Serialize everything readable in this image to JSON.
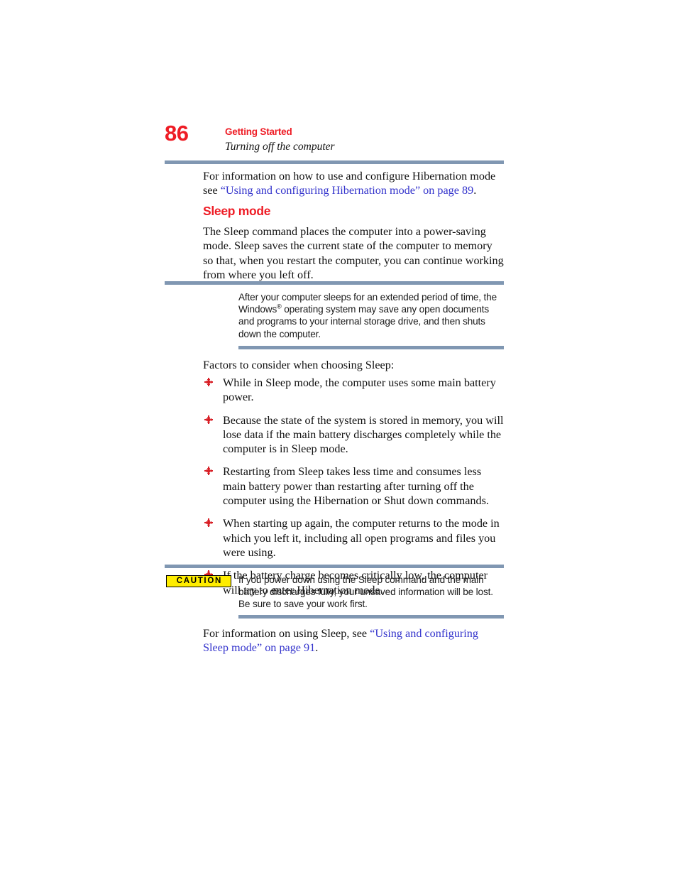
{
  "header": {
    "page_number": "86",
    "chapter": "Getting Started",
    "section": "Turning off the computer"
  },
  "colors": {
    "accent_red": "#ee1c25",
    "rule_blue": "#8097b2",
    "link_blue": "#3333cc",
    "caution_yellow": "#ffed00"
  },
  "content": {
    "hibernation_paragraph": {
      "lead": "For information on how to use and configure Hibernation mode see ",
      "link": "“Using and configuring Hibernation mode” on page 89",
      "tail": "."
    },
    "sleep_heading": "Sleep mode",
    "sleep_description": "The Sleep command places the computer into a power-saving mode. Sleep saves the current state of the computer to memory so that, when you restart the computer, you can continue working from where you left off.",
    "note": {
      "text_before_mark": "After your computer sleeps for an extended period of time, the Windows",
      "trademark": "®",
      "text_after_mark": " operating system may save any open documents and programs to your internal storage drive, and then shuts down the computer."
    },
    "factors_intro": "Factors to consider when choosing Sleep:",
    "bullets": [
      "While in Sleep mode, the computer uses some main battery power.",
      "Because the state of the system is stored in memory, you will lose data if the main battery discharges completely while the computer is in Sleep mode.",
      "Restarting from Sleep takes less time and consumes less main battery power than restarting after turning off the computer using the Hibernation or Shut down commands.",
      "When starting up again, the computer returns to the mode in which you left it, including all open programs and files you were using.",
      "If the battery charge becomes critically low, the computer will try to enter Hibernation mode."
    ],
    "caution": {
      "label": "CAUTION",
      "text": "If you power down using the Sleep command and the main battery discharges fully, your unsaved information will be lost. Be sure to save your work first."
    },
    "final_paragraph": {
      "lead": "For information on using Sleep, see ",
      "link": "“Using and configuring Sleep mode” on page 91",
      "tail": "."
    }
  }
}
